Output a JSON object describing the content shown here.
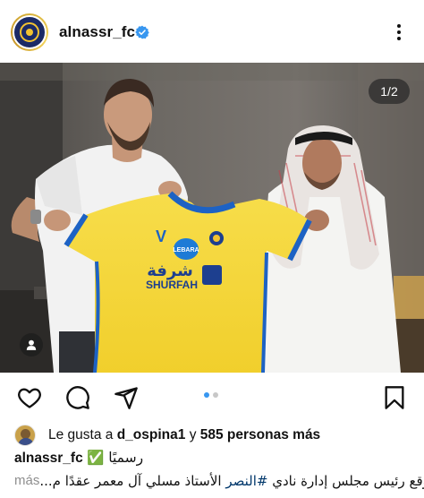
{
  "post": {
    "username": "alnassr_fc",
    "verified": true,
    "photo_counter": "1/2",
    "carousel_index": 1,
    "carousel_total": 2
  },
  "photo": {
    "jersey_sponsor_1": "LEBARA",
    "jersey_sponsor_2": "SHURFAH",
    "jersey_sponsor_2_arabic": "شرفة"
  },
  "likes": {
    "prefix": "Le gusta a",
    "user": "d_ospina1",
    "connector": "y",
    "others": "585 personas más"
  },
  "caption": {
    "user": "alnassr_fc",
    "line1_text": "رسميًا ✅",
    "line2_prefix": "وقع رئيس مجلس إدارة نادي ",
    "line2_hashtag": "#النصر",
    "line2_suffix": " الأستاذ مسلي آل معمر عقدًا م...",
    "more_label": "más"
  },
  "colors": {
    "verified_blue": "#3897f0",
    "jersey_yellow": "#f7d83b",
    "jersey_blue": "#1d62c4"
  },
  "icons": [
    "more-options-icon",
    "verified-icon",
    "like-icon",
    "comment-icon",
    "share-icon",
    "save-icon",
    "tag-user-icon"
  ]
}
